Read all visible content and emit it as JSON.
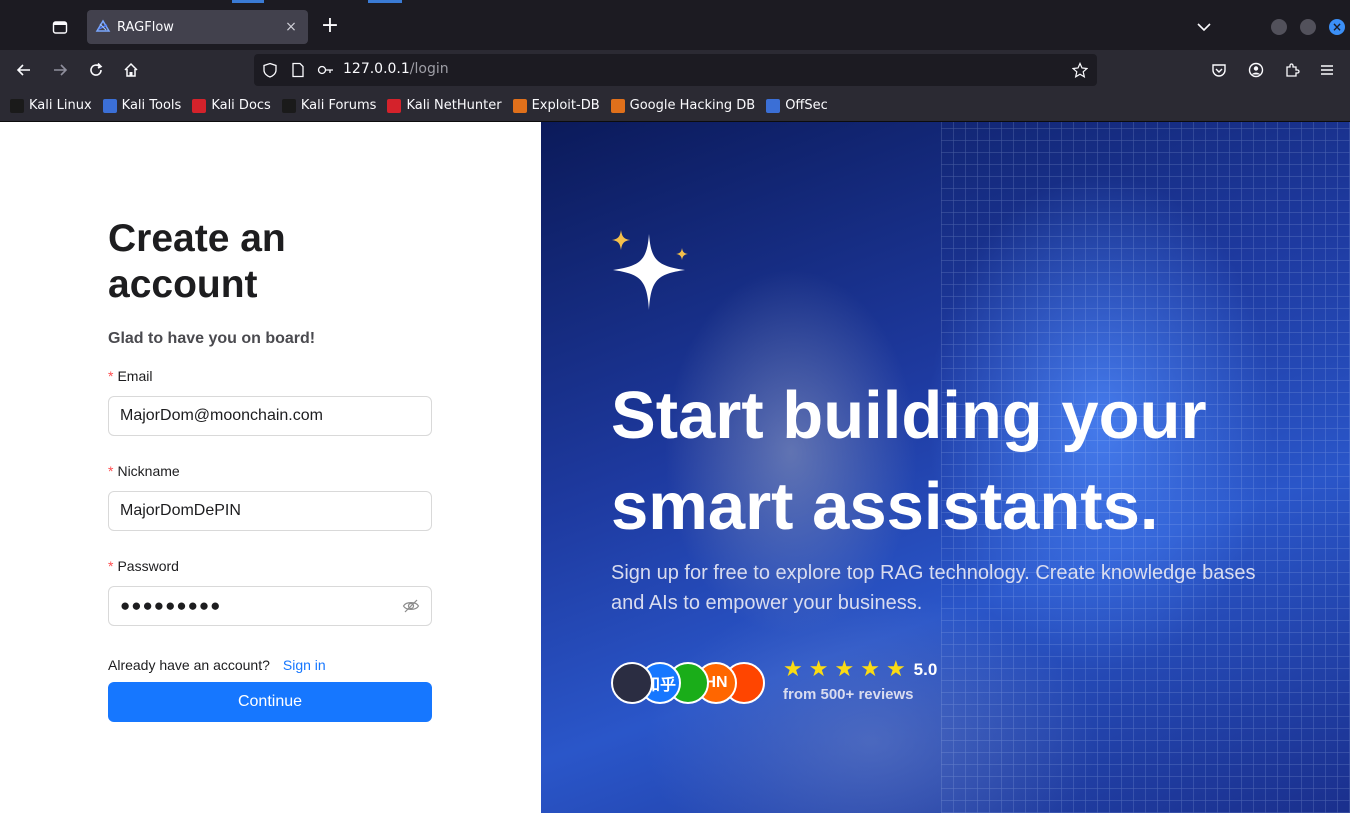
{
  "browser": {
    "tab_title": "RAGFlow",
    "tab_close": "×",
    "new_tab": "+",
    "url_host": "127.0.0.1",
    "url_path": "/login",
    "close_glyph": "×"
  },
  "bookmarks": [
    {
      "label": "Kali Linux",
      "icon": "kali-dragon-icon",
      "color": "#1a1a1a"
    },
    {
      "label": "Kali Tools",
      "icon": "kali-tools-icon",
      "color": "#3b6fd6"
    },
    {
      "label": "Kali Docs",
      "icon": "kali-docs-icon",
      "color": "#d4222b"
    },
    {
      "label": "Kali Forums",
      "icon": "kali-forums-icon",
      "color": "#1a1a1a"
    },
    {
      "label": "Kali NetHunter",
      "icon": "nethunter-icon",
      "color": "#d4222b"
    },
    {
      "label": "Exploit-DB",
      "icon": "exploit-db-icon",
      "color": "#e0701b"
    },
    {
      "label": "Google Hacking DB",
      "icon": "ghdb-icon",
      "color": "#e0701b"
    },
    {
      "label": "OffSec",
      "icon": "offsec-icon",
      "color": "#3b6fd6"
    }
  ],
  "form": {
    "title": "Create an account",
    "subtitle": "Glad to have you on board!",
    "required_mark": "*",
    "email_label": "Email",
    "email_value": "MajorDom@moonchain.com",
    "nickname_label": "Nickname",
    "nickname_value": "MajorDomDePIN",
    "password_label": "Password",
    "password_value": "●●●●●●●●●",
    "already_text": "Already have an account?",
    "signin_link": "Sign in",
    "continue_button": "Continue"
  },
  "hero": {
    "title_line1": "Start building your",
    "title_line2": "smart assistants.",
    "subtitle": "Sign up for free to explore top RAG technology. Create knowledge bases and AIs to empower your business.",
    "avatars": [
      {
        "name": "github-avatar",
        "text": "",
        "color": "#2b2d42"
      },
      {
        "name": "zhihu-avatar",
        "text": "知乎",
        "color": "#1677ff"
      },
      {
        "name": "wechat-avatar",
        "text": "",
        "color": "#1aad19"
      },
      {
        "name": "hackernews-avatar",
        "text": "HN",
        "color": "#ff6600"
      },
      {
        "name": "reddit-avatar",
        "text": "",
        "color": "#ff4500"
      }
    ],
    "star_count": 5,
    "star_glyph": "★",
    "rating": "5.0",
    "reviews": "from 500+ reviews"
  }
}
